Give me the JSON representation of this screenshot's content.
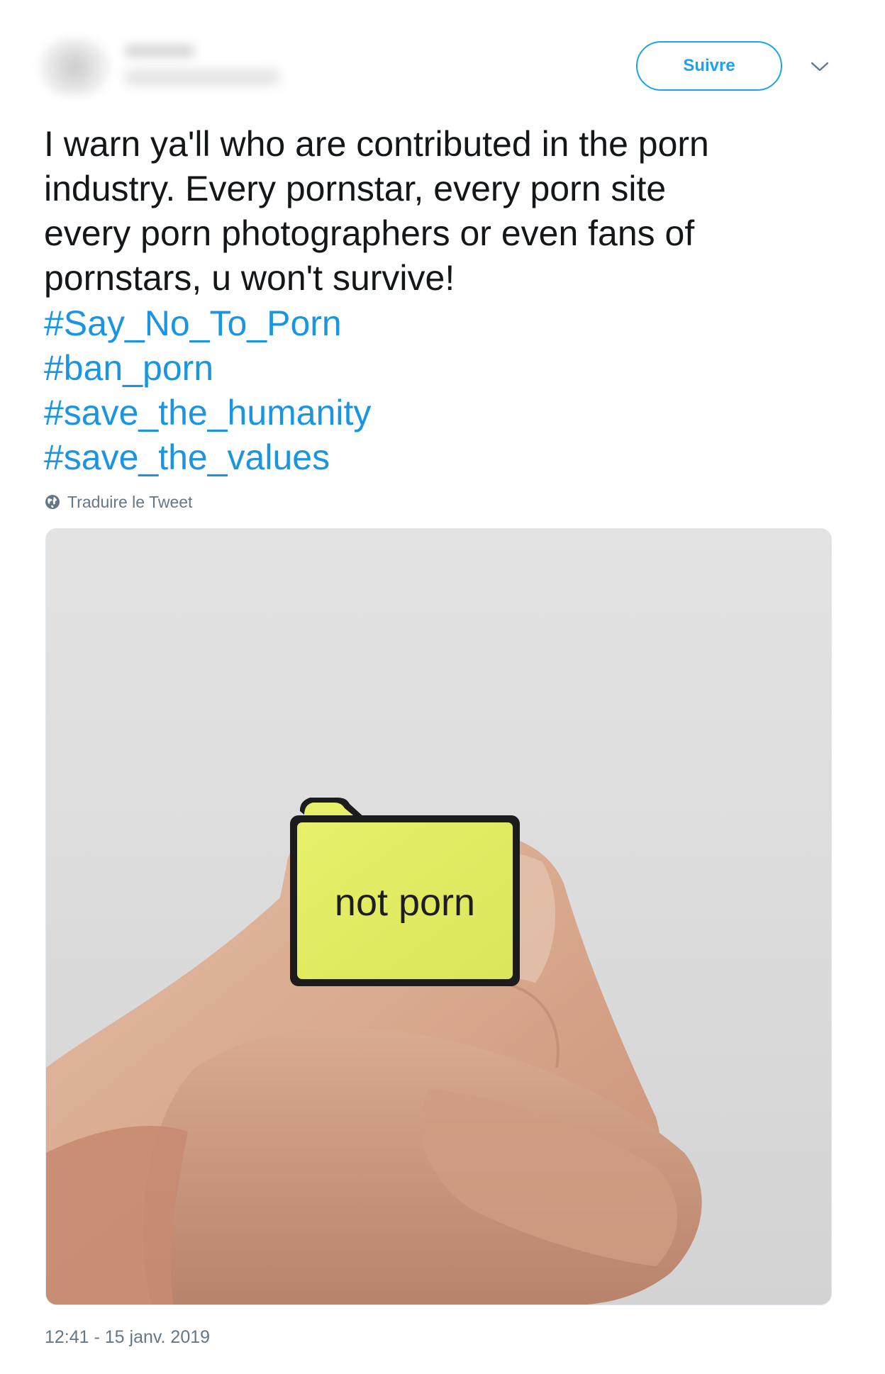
{
  "header": {
    "follow_label": "Suivre"
  },
  "tweet": {
    "text_lines": [
      "I warn ya'll who are contributed in the porn",
      "industry. Every pornstar, every porn site",
      "every porn photographers or even fans of",
      "pornstars, u won't survive!"
    ],
    "hashtags": [
      "#Say_No_To_Porn",
      "#ban_porn",
      "#save_the_humanity",
      "#save_the_values"
    ],
    "translate_label": "Traduire le Tweet",
    "media": {
      "pin_text": "not porn"
    },
    "timestamp": "12:41 - 15 janv. 2019"
  },
  "colors": {
    "accent": "#1da1f2",
    "hashtag": "#1b95e0",
    "meta_text": "#657786",
    "pin_yellow": "#e3ef63"
  },
  "icons": {
    "menu": "chevron-down-icon",
    "translate": "globe-icon"
  }
}
